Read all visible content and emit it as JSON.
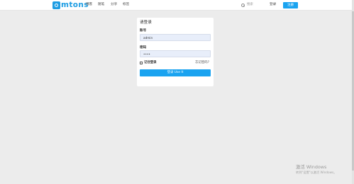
{
  "header": {
    "logo_text": "mtons",
    "nav": [
      "博客",
      "随笔",
      "分享",
      "标签"
    ],
    "search_placeholder": "搜索",
    "login_label": "登录",
    "register_label": "注册"
  },
  "login": {
    "title": "请登录",
    "username_label": "账号",
    "username_value": "admin",
    "password_label": "密码",
    "password_value": "••••",
    "remember_label": "记住登录",
    "forgot_label": "忘记密码?",
    "submit_label": "登录 Use It"
  },
  "watermark": {
    "line1": "激活 Windows",
    "line2": "转到\"设置\"以激活 Windows。"
  },
  "colors": {
    "brand": "#1e9de3",
    "button": "#1aa3f0",
    "background": "#ececec"
  }
}
